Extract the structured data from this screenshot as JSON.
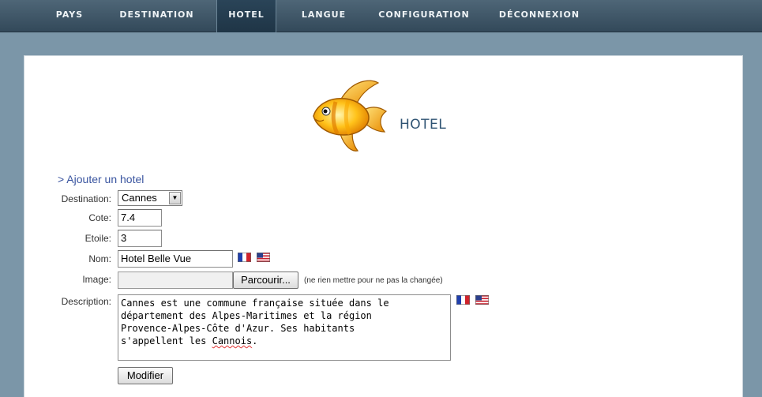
{
  "nav": {
    "items": [
      {
        "label": "PAYS"
      },
      {
        "label": "DESTINATION"
      },
      {
        "label": "HOTEL",
        "active": true
      },
      {
        "label": "LANGUE"
      },
      {
        "label": "CONFIGURATION"
      },
      {
        "label": "DÉCONNEXION"
      }
    ]
  },
  "page": {
    "title": "HOTEL",
    "add_link": "> Ajouter un hotel",
    "logo_icon": "fish-icon"
  },
  "form": {
    "destination_label": "Destination:",
    "destination_value": "Cannes",
    "cote_label": "Cote:",
    "cote_value": "7.4",
    "etoile_label": "Etoile:",
    "etoile_value": "3",
    "nom_label": "Nom:",
    "nom_value": "Hotel Belle Vue",
    "image_label": "Image:",
    "browse_button": "Parcourir...",
    "image_hint": "(ne rien mettre pour ne pas la changée)",
    "description_label": "Description:",
    "description_value_main": "Cannes est une commune française située dans le\ndépartement des Alpes-Maritimes et la région\nProvence-Alpes-Côte d'Azur. Ses habitants\ns'appellent les ",
    "description_value_misspelled": "Cannois",
    "description_value_end": ".",
    "submit_button": "Modifier"
  },
  "icons": {
    "flag_fr": "france-flag-icon",
    "flag_us": "usa-flag-icon"
  },
  "colors": {
    "nav_bg": "#3e5668",
    "page_bg": "#7b96a8",
    "title_color": "#2f5373",
    "link_color": "#3a55a0"
  }
}
